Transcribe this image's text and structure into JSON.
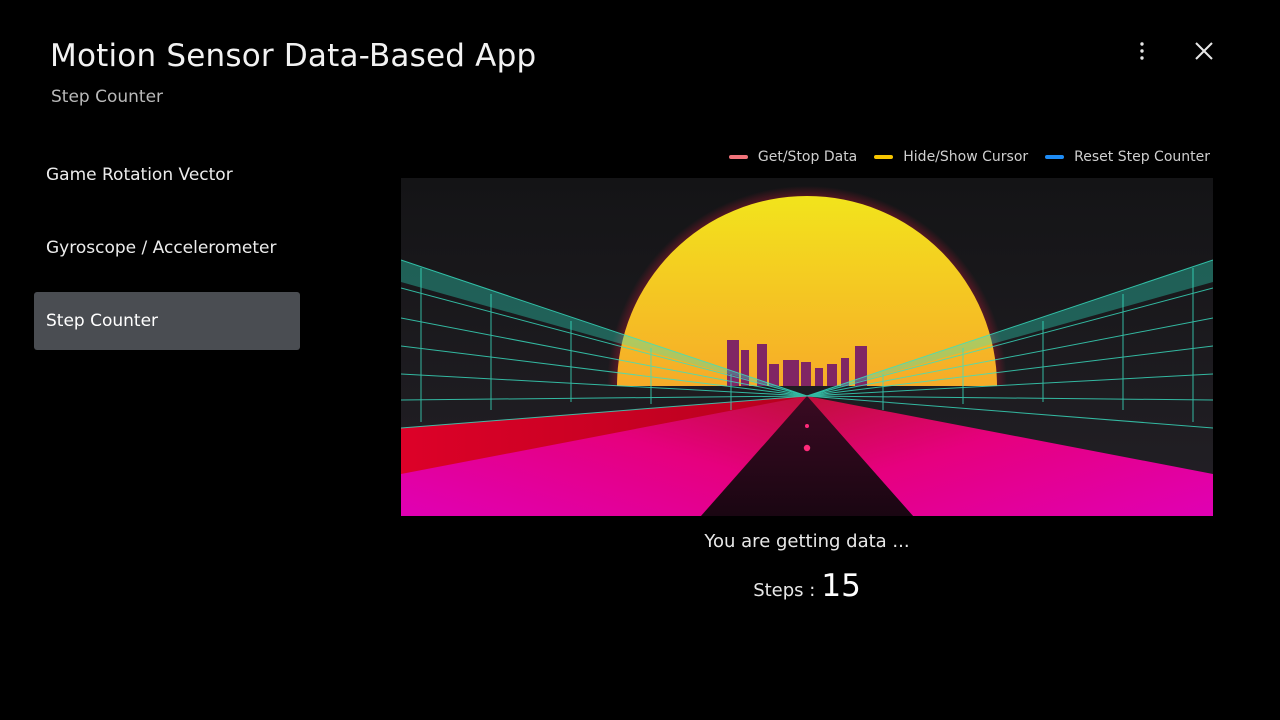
{
  "header": {
    "title": "Motion Sensor Data-Based App",
    "subtitle": "Step Counter"
  },
  "toolbar": {
    "more_icon": "more-vertical-icon",
    "close_icon": "close-icon"
  },
  "sidebar": {
    "items": [
      {
        "label": "Game Rotation Vector",
        "selected": false
      },
      {
        "label": "Gyroscope / Accelerometer",
        "selected": false
      },
      {
        "label": "Step Counter",
        "selected": true
      }
    ]
  },
  "legend": {
    "items": [
      {
        "label": "Get/Stop Data",
        "color": "#f0737a"
      },
      {
        "label": "Hide/Show Cursor",
        "color": "#f7c600"
      },
      {
        "label": "Reset Step Counter",
        "color": "#1e8cf5"
      }
    ]
  },
  "status": {
    "message": "You are getting data ...",
    "steps_label": "Steps :",
    "steps_value": "15"
  },
  "colors": {
    "background": "#000000",
    "selected_item": "#4a4d52",
    "grid_line": "#39e0c2",
    "sun_top": "#f2e41c",
    "sun_bottom": "#f7661e",
    "road_magenta": "#e0009c"
  }
}
